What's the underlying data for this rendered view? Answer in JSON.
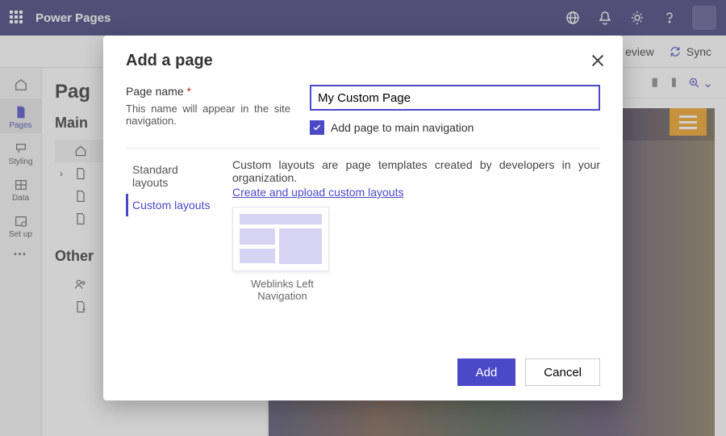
{
  "header": {
    "app_title": "Power Pages"
  },
  "action_bar": {
    "preview": "eview",
    "sync": "Sync"
  },
  "rail": {
    "pages": "Pages",
    "styling": "Styling",
    "data": "Data",
    "setup": "Set up"
  },
  "side_panel": {
    "title": "Pag",
    "section_main": "Main",
    "section_other": "Other"
  },
  "modal": {
    "title": "Add a page",
    "field_label": "Page name",
    "field_help": "This name will appear in the site navigation.",
    "field_value": "My Custom Page",
    "checkbox_label": "Add page to main navigation",
    "tab_standard": "Standard layouts",
    "tab_custom": "Custom layouts",
    "custom_desc": "Custom layouts are page templates created by developers in your organization.",
    "custom_link": "Create and upload custom layouts",
    "card_label": "Weblinks Left Navigation",
    "btn_add": "Add",
    "btn_cancel": "Cancel"
  }
}
